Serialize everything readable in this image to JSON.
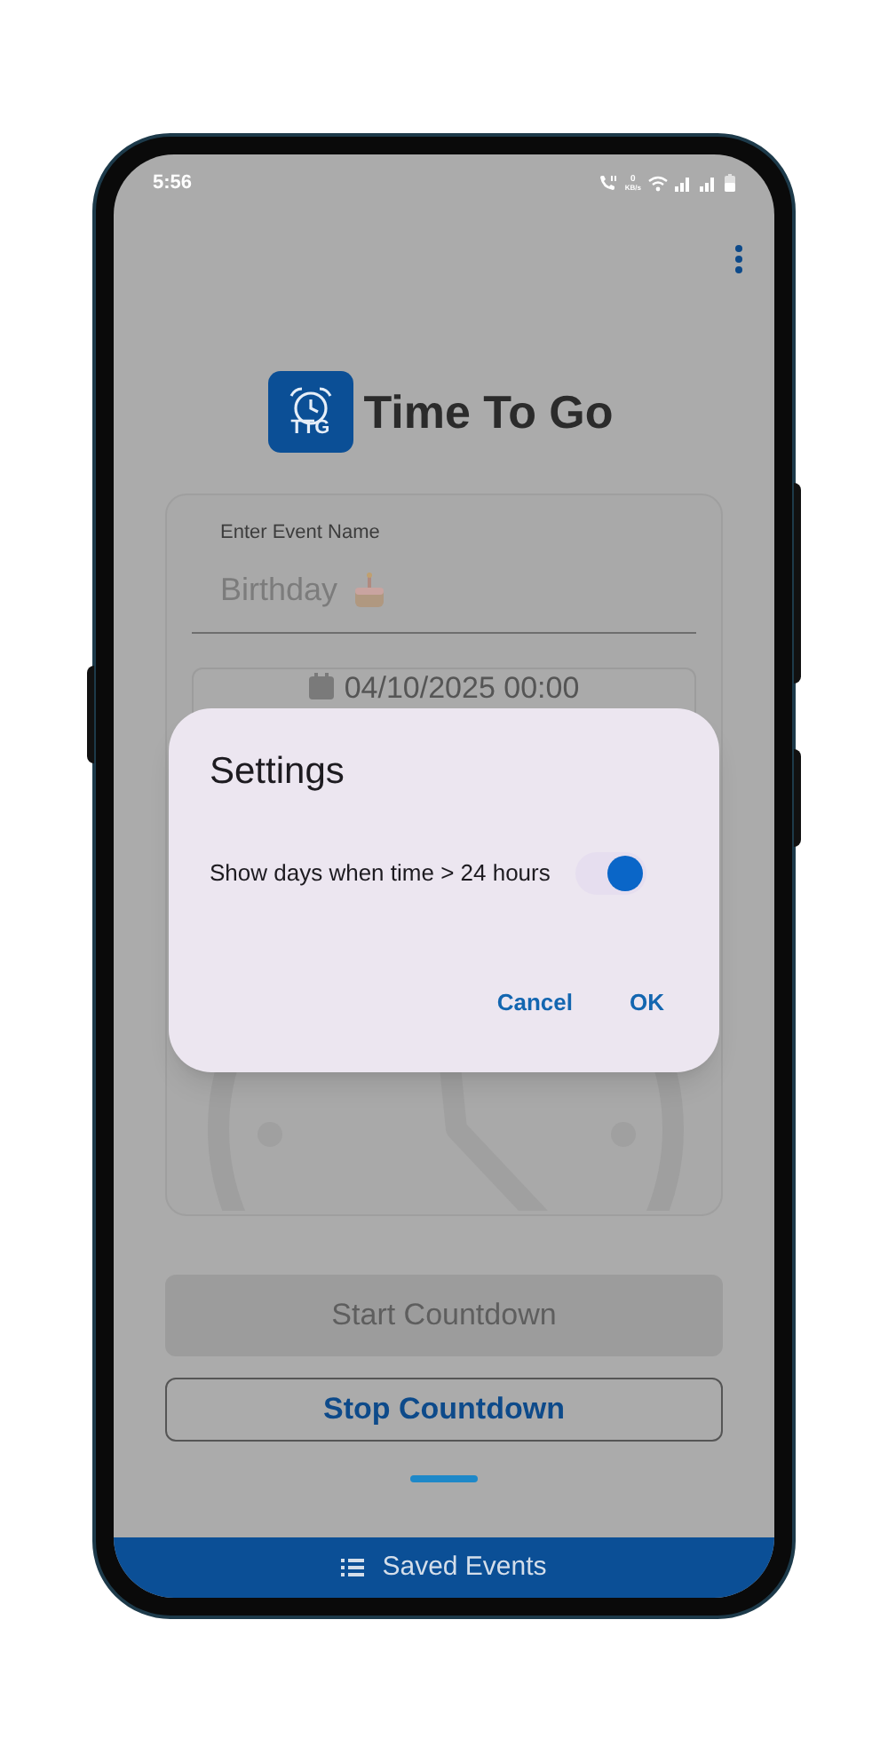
{
  "status_bar": {
    "time": "5:56",
    "speed_value": "0",
    "speed_unit": "KB/s"
  },
  "app": {
    "logo_text": "TTG",
    "title": "Time To Go"
  },
  "event_field": {
    "label": "Enter Event Name",
    "placeholder": "Birthday"
  },
  "date_field": {
    "value": "04/10/2025 00:00"
  },
  "buttons": [
    {
      "label": "Start Countdown",
      "kind": "filled",
      "disabled": true
    },
    {
      "label": "Stop Countdown",
      "kind": "outlined",
      "disabled": false
    }
  ],
  "bottom_bar": {
    "label": "Saved Events"
  },
  "dialog": {
    "title": "Settings",
    "options": [
      {
        "label": "Show days when time > 24 hours",
        "on": true
      }
    ],
    "actions": [
      "Cancel",
      "OK"
    ]
  }
}
